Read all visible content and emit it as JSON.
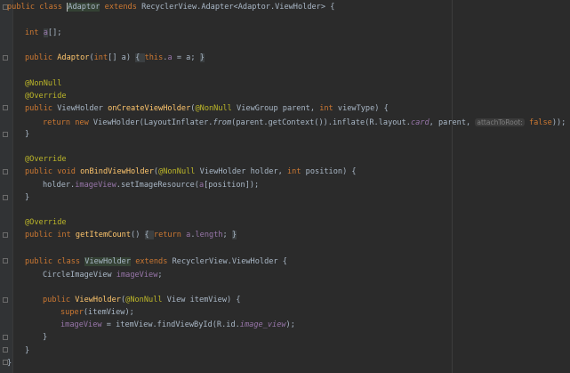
{
  "editor": {
    "lines": {
      "l1": {
        "t1": "public class ",
        "t2": "Adaptor",
        "t3": " extends ",
        "t4": "RecyclerView.Adapter<",
        "t5": "Adaptor",
        "t6": ".ViewHolder> {"
      },
      "l2": {
        "t1": "int ",
        "t2": "a",
        "t3": "[];"
      },
      "l3": {
        "t1": "public ",
        "t2": "Adaptor",
        "t3": "(",
        "t4": "int",
        "t5": "[] a) ",
        "t6": "{ ",
        "t7": "this",
        "t8": ".",
        "t9": "a",
        "t10": " = a; ",
        "t11": "}"
      },
      "l4": {
        "t1": "@NonNull"
      },
      "l5": {
        "t1": "@Override"
      },
      "l6": {
        "t1": "public ",
        "t2": "ViewHolder ",
        "t3": "onCreateViewHolder",
        "t4": "(",
        "t5": "@NonNull",
        "t6": " ViewGroup parent, ",
        "t7": "int",
        "t8": " viewType) {"
      },
      "l7": {
        "t1": "return new ",
        "t2": "ViewHolder(LayoutInflater.",
        "t3": "from",
        "t4": "(parent.getContext()).inflate(R.layout.",
        "t5": "card",
        "t6": ", parent, ",
        "t7": "attachToRoot:",
        "t8": " false",
        "t9": "));"
      },
      "l8": {
        "t1": "}"
      },
      "l9": {
        "t1": "@Override"
      },
      "l10": {
        "t1": "public void ",
        "t2": "onBindViewHolder",
        "t3": "(",
        "t4": "@NonNull",
        "t5": " ViewHolder holder, ",
        "t6": "int",
        "t7": " position) {"
      },
      "l11": {
        "t1": "holder.",
        "t2": "imageView",
        "t3": ".setImageResource(",
        "t4": "a",
        "t5": "[position]);"
      },
      "l12": {
        "t1": "}"
      },
      "l13": {
        "t1": "@Override"
      },
      "l14": {
        "t1": "public int ",
        "t2": "getItemCount",
        "t3": "() ",
        "t4": "{ ",
        "t5": "return ",
        "t6": "a",
        "t7": ".",
        "t8": "length",
        "t9": "; ",
        "t10": "}"
      },
      "l15": {
        "t1": "public class ",
        "t2": "ViewHolder",
        "t3": " extends ",
        "t4": "RecyclerView.ViewHolder {"
      },
      "l16": {
        "t1": "CircleImageView ",
        "t2": "imageView",
        "t3": ";"
      },
      "l17": {
        "t1": "public ",
        "t2": "ViewHolder",
        "t3": "(",
        "t4": "@NonNull",
        "t5": " View itemView) {"
      },
      "l18": {
        "t1": "super",
        "t2": "(itemView);"
      },
      "l19": {
        "t1": "imageView",
        "t2": " = itemView.findViewById(R.id.",
        "t3": "image_view",
        "t4": ");"
      },
      "l20": {
        "t1": "}"
      },
      "l21": {
        "t1": "}"
      },
      "l22": {
        "t1": "}"
      }
    }
  },
  "colors": {
    "background": "#2b2b2b",
    "keyword": "#cc7832",
    "annotation": "#bbb529",
    "method": "#ffc66d",
    "field": "#9876aa",
    "text": "#a9b7c6"
  }
}
